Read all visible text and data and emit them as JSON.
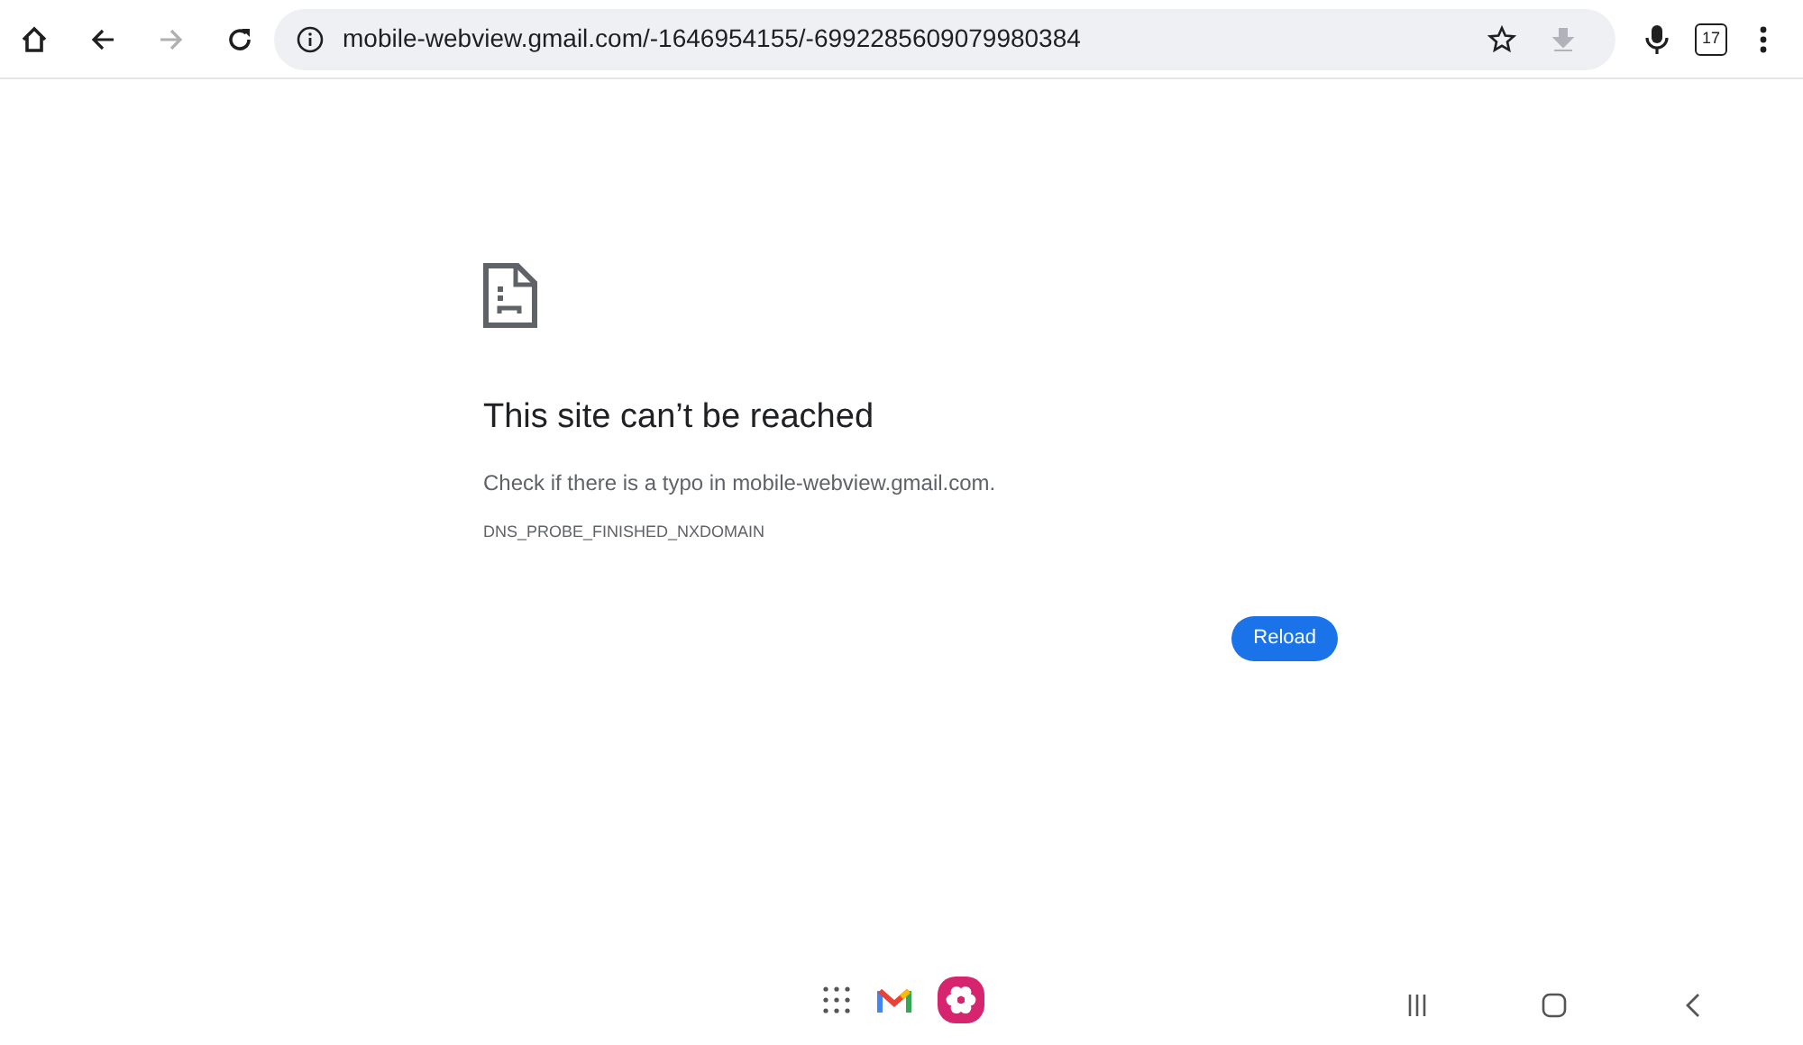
{
  "toolbar": {
    "back": {
      "disabled": false
    },
    "forward": {
      "disabled": true
    },
    "url": "mobile-webview.gmail.com/-1646954155/-6992285609079980384",
    "download": {
      "disabled": true
    },
    "tab_count": "17"
  },
  "error": {
    "title": "This site can’t be reached",
    "message": "Check if there is a typo in mobile-webview.gmail.com.",
    "code": "DNS_PROBE_FINISHED_NXDOMAIN",
    "button": "Reload"
  },
  "taskbar": {
    "apps": [
      {
        "kind": "grid"
      },
      {
        "kind": "mail"
      },
      {
        "kind": "flower"
      }
    ]
  }
}
